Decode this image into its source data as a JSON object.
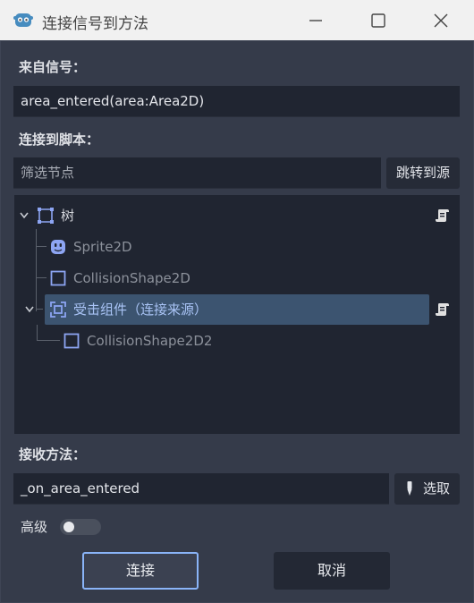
{
  "window": {
    "title": "连接信号到方法",
    "min_icon": "minimize-icon",
    "max_icon": "maximize-icon",
    "close_icon": "close-icon"
  },
  "signal": {
    "label": "来自信号：",
    "value": "area_entered(area:Area2D)"
  },
  "script": {
    "label": "连接到脚本：",
    "filter_placeholder": "筛选节点",
    "goto_source_label": "跳转到源"
  },
  "tree": {
    "items": [
      {
        "label": "树",
        "icon": "node2d-icon",
        "state": "normal",
        "has_script": true
      },
      {
        "label": "Sprite2D",
        "icon": "sprite2d-icon",
        "state": "disabled"
      },
      {
        "label": "CollisionShape2D",
        "icon": "collision-shape-icon",
        "state": "disabled"
      },
      {
        "label": "受击组件（连接来源）",
        "icon": "area2d-icon",
        "state": "selected",
        "has_script": true
      },
      {
        "label": "CollisionShape2D2",
        "icon": "collision-shape-icon",
        "state": "disabled"
      }
    ]
  },
  "method": {
    "label": "接收方法：",
    "value": "_on_area_entered",
    "pick_label": "选取"
  },
  "advanced": {
    "label": "高级",
    "enabled": false
  },
  "actions": {
    "connect_label": "连接",
    "cancel_label": "取消"
  },
  "colors": {
    "accent": "#8ab4f8",
    "selection": "#3c5470",
    "background": "#353b4a",
    "field": "#202531"
  }
}
